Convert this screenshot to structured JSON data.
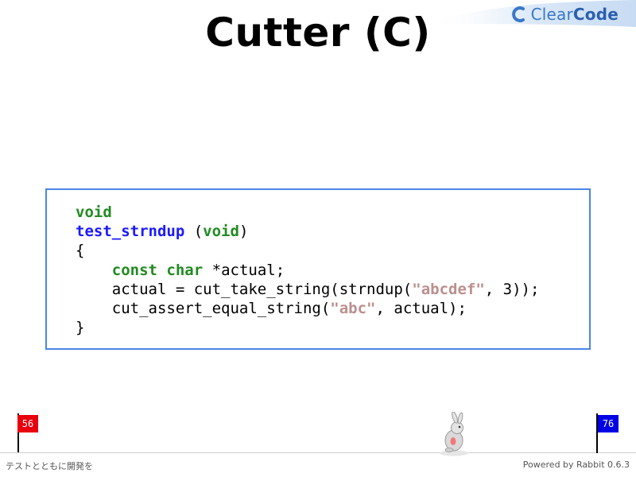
{
  "slide": {
    "title": "Cutter (C)"
  },
  "logo": {
    "prefix": "Clear",
    "suffix": "Code",
    "color": "#3a78c7"
  },
  "code": {
    "lines": [
      [
        {
          "t": "void",
          "c": "kw"
        }
      ],
      [
        {
          "t": "test_strndup",
          "c": "fn"
        },
        {
          "t": " ("
        },
        {
          "t": "void",
          "c": "kw"
        },
        {
          "t": ")"
        }
      ],
      [
        {
          "t": "{"
        }
      ],
      [
        {
          "t": "    "
        },
        {
          "t": "const",
          "c": "kw"
        },
        {
          "t": " "
        },
        {
          "t": "char",
          "c": "kw"
        },
        {
          "t": " *actual;"
        }
      ],
      [
        {
          "t": "    actual = cut_take_string(strndup("
        },
        {
          "t": "\"abcdef\"",
          "c": "str"
        },
        {
          "t": ", 3));"
        }
      ],
      [
        {
          "t": "    cut_assert_equal_string("
        },
        {
          "t": "\"abc\"",
          "c": "str"
        },
        {
          "t": ", actual);"
        }
      ],
      [
        {
          "t": "}"
        }
      ]
    ],
    "border_color": "#4a86e8"
  },
  "progress": {
    "start_page": "56",
    "end_page": "76",
    "start_color": "#e8000d",
    "end_color": "#0000e6"
  },
  "footer": {
    "left": "テストとともに開発を",
    "right": "Powered by Rabbit 0.6.3"
  }
}
